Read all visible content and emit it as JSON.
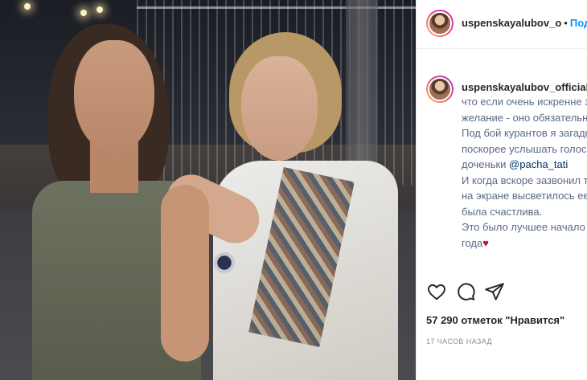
{
  "post": {
    "username": "uspenskayalubov_o",
    "follow_label": "Подпи",
    "separator": "•"
  },
  "caption": {
    "username": "uspenskayalubov_official",
    "verified_glyph": "✓",
    "lines": [
      "что если очень искренне за",
      "желание - оно обязательно",
      "Под бой курантов я загады",
      "поскорее услышать голос м",
      "доченьки ",
      "И когда вскоре зазвонил те",
      "на экране высветилось ее и",
      "была счастлива.",
      "Это было лучшее начало м",
      "года"
    ],
    "mention": "@pacha_tati",
    "heart": "♥"
  },
  "actions": {
    "like": "heart-icon",
    "comment": "comment-icon",
    "share": "share-icon"
  },
  "likes_text": "57 290 отметок \"Нравится\"",
  "timestamp": "17 часов назад",
  "colors": {
    "accent": "#0095f6",
    "heart": "#b5123d",
    "mention": "#00376b"
  }
}
